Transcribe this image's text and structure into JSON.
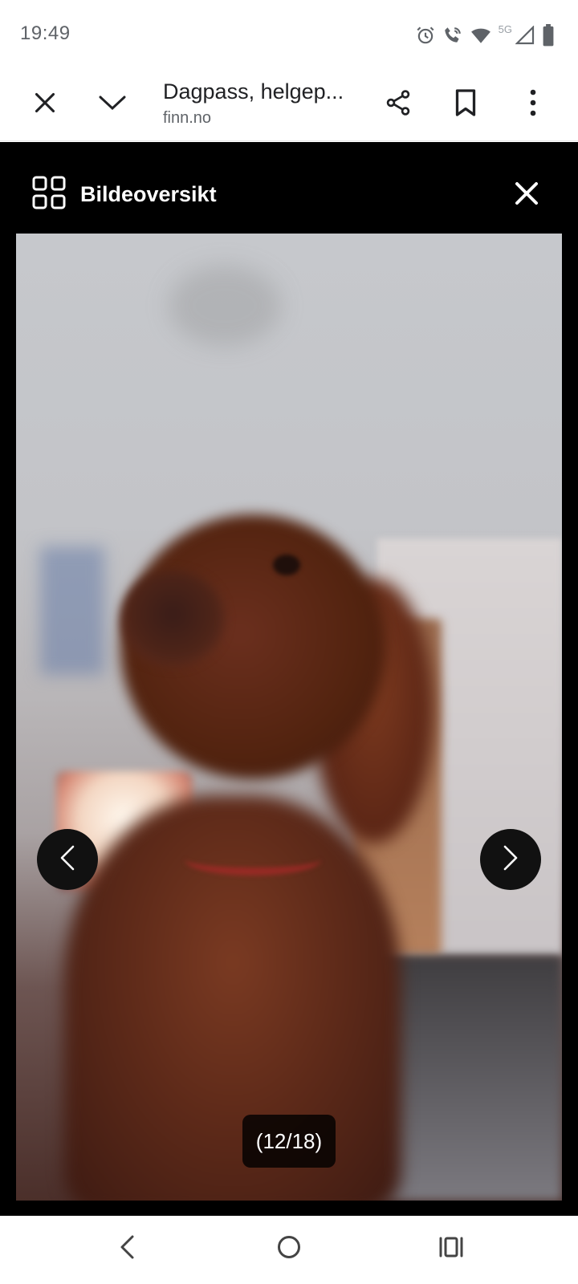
{
  "status_bar": {
    "time": "19:49",
    "network_label": "5G",
    "icons": [
      "alarm-icon",
      "wifi-call-icon",
      "wifi-icon",
      "signal-icon",
      "battery-icon"
    ]
  },
  "toolbar": {
    "title": "Dagpass, helgep...",
    "url": "finn.no",
    "icons": [
      "close-icon",
      "chevron-down-icon",
      "share-icon",
      "bookmark-icon",
      "more-vert-icon"
    ]
  },
  "gallery": {
    "overview_label": "Bildeoversikt",
    "counter": "(12/18)",
    "current_image": 12,
    "total_images": 18
  },
  "system_nav": {
    "icons": [
      "back-icon",
      "home-icon",
      "recents-icon"
    ]
  },
  "colors": {
    "gallery_background": "#000000",
    "toolbar_text": "#202124",
    "secondary_text": "#5f6368"
  }
}
